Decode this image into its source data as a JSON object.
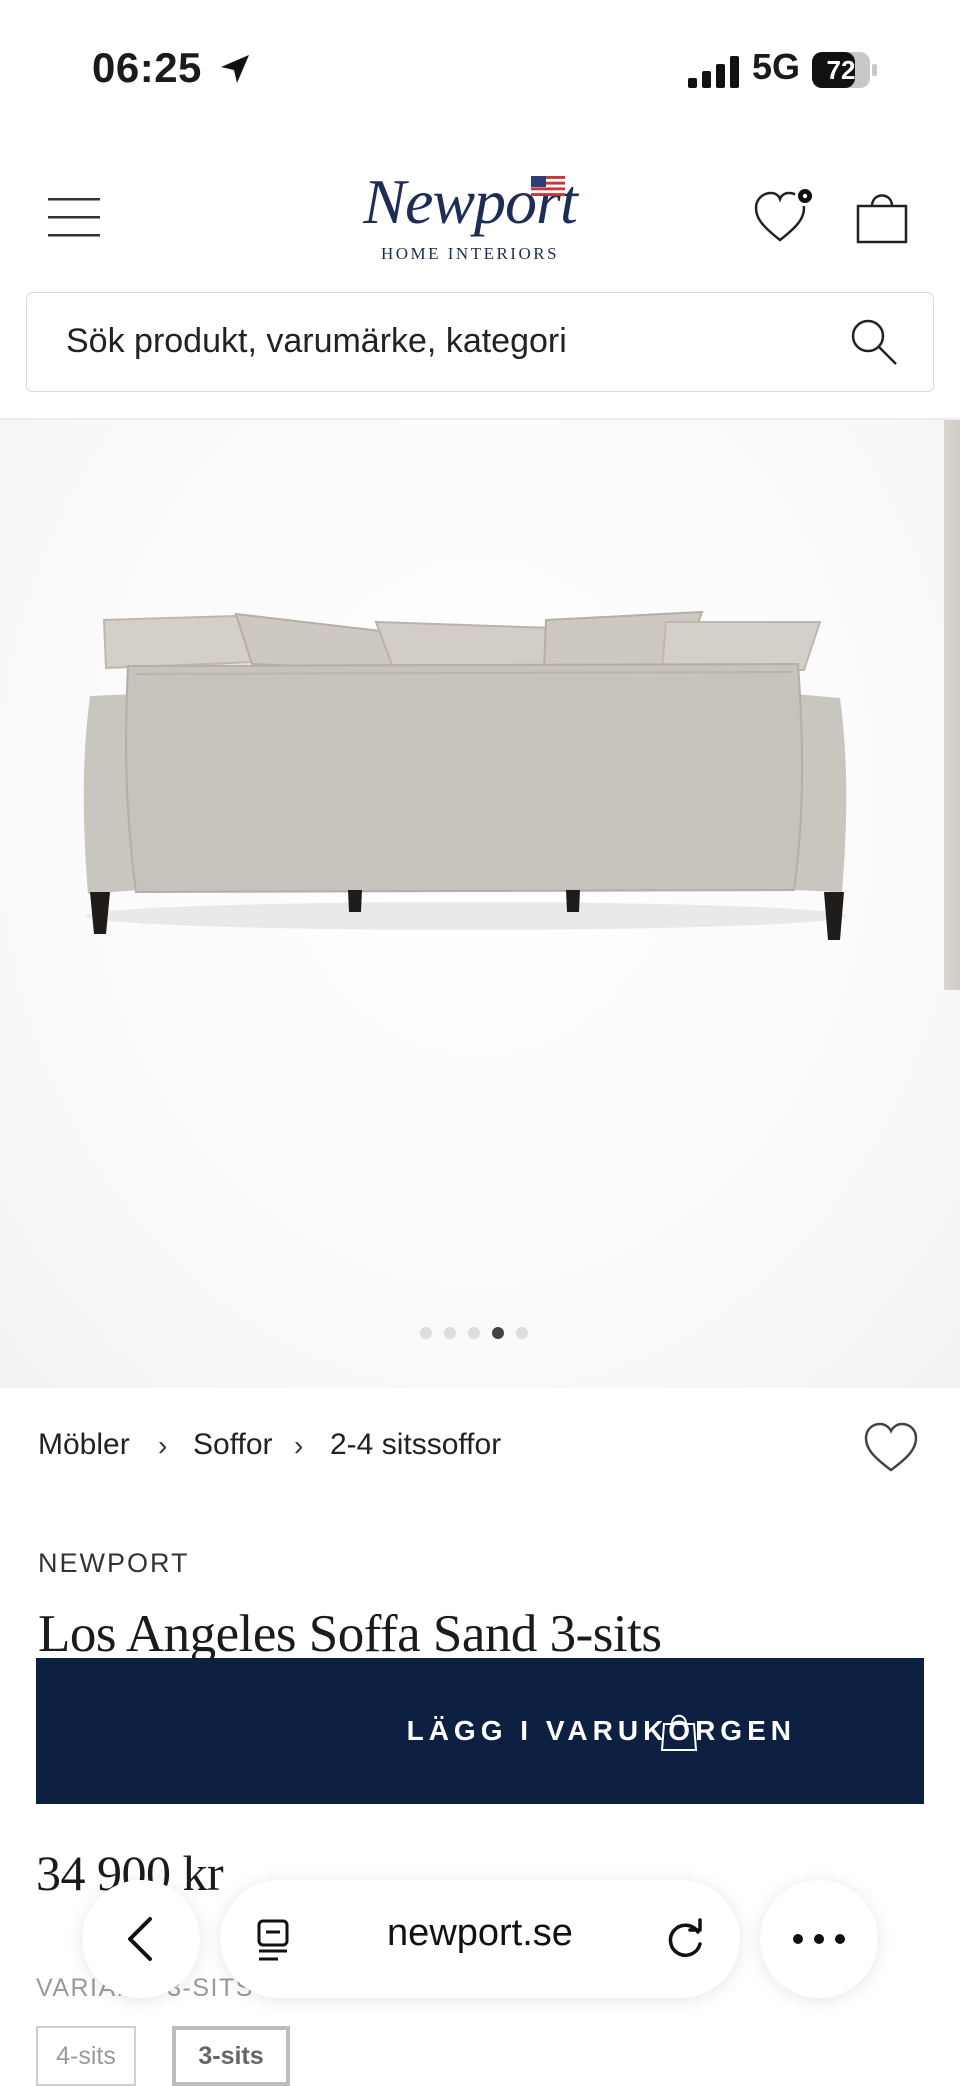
{
  "status_bar": {
    "time": "06:25",
    "network": "5G",
    "battery": "72",
    "icons": [
      "location-arrow-icon",
      "signal-bars-icon",
      "battery-icon"
    ]
  },
  "header": {
    "logo_script": "Newport",
    "logo_sub": "HOME INTERIORS",
    "icons": [
      "menu-icon",
      "flag-icon",
      "heart-icon",
      "cart-bag-icon"
    ]
  },
  "search": {
    "placeholder": "Sök produkt, varumärke, kategori",
    "icon": "search-icon"
  },
  "gallery": {
    "slide_count": 5,
    "active_slide": 4
  },
  "breadcrumb": {
    "items": [
      "Möbler",
      "Soffor",
      "2-4 sitssoffor"
    ],
    "separator": "›"
  },
  "product": {
    "brand": "NEWPORT",
    "title": "Los Angeles Soffa Sand 3-sits",
    "price": "34 900 kr",
    "add_to_cart_label": "LÄGG I VARUKORGEN",
    "variant_label": "VARIANT: 3-SITS",
    "variants": [
      "4-sits",
      "3-sits"
    ],
    "selected_variant": "3-sits"
  },
  "browser": {
    "url": "newport.se",
    "icons": [
      "back-chevron-icon",
      "reader-icon",
      "reload-icon",
      "more-icon"
    ]
  },
  "colors": {
    "navy": "#0d2042",
    "logo_blue": "#1f2c56"
  }
}
